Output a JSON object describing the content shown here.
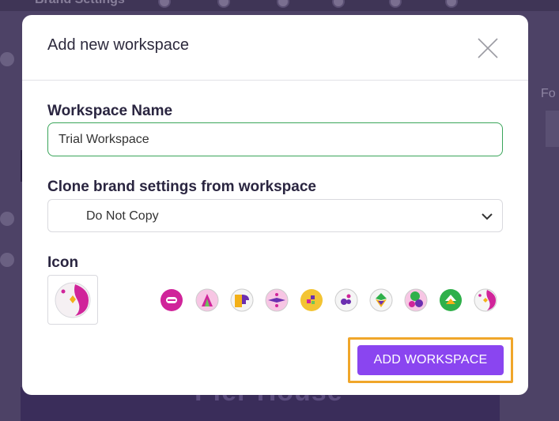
{
  "background": {
    "title": "Brand Settings"
  },
  "modal": {
    "title": "Add new workspace",
    "workspace_name_label": "Workspace Name",
    "workspace_name_value": "Trial Workspace",
    "clone_label": "Clone brand settings from workspace",
    "clone_selected": "Do Not Copy",
    "icon_label": "Icon",
    "add_button_label": "ADD WORKSPACE"
  },
  "icon_options": [
    "magenta-e-icon",
    "pink-mountain-icon",
    "yellow-purple-shape-icon",
    "purple-diamond-icon",
    "yellow-blocks-icon",
    "purple-dots-icon",
    "green-diamond-icon",
    "pink-green-blob-icon",
    "green-arrow-icon",
    "pink-half-circle-icon"
  ],
  "colors": {
    "accent": "#8a45f0",
    "input_focus_border": "#3aa55a",
    "highlight_outline": "#f0a62a"
  }
}
